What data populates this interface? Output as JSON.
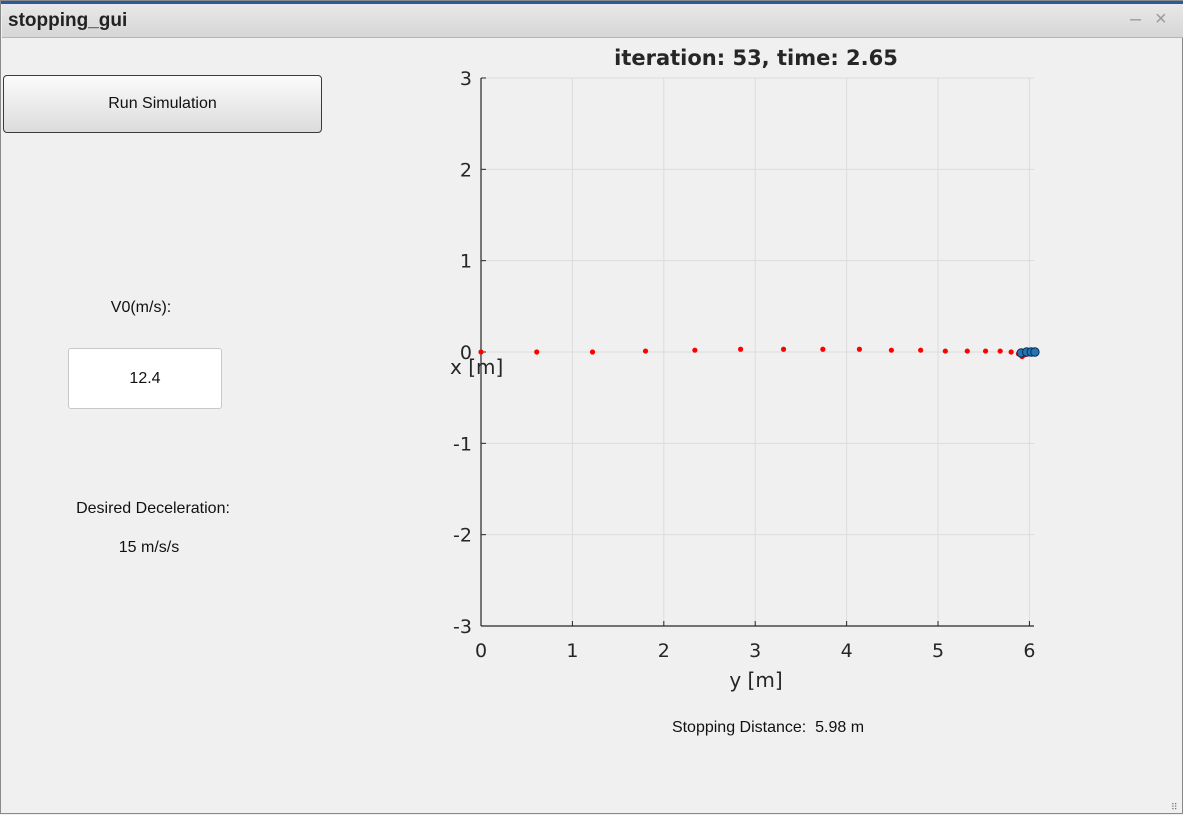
{
  "window": {
    "title": "stopping_gui",
    "minimize_glyph": "–",
    "close_glyph": "×"
  },
  "controls": {
    "run_button_label": "Run Simulation",
    "v0_label": "V0(m/s):",
    "v0_value": "12.4",
    "decel_label": "Desired Deceleration:",
    "decel_value": "15 m/s/s",
    "stopping_text": "Stopping Distance:  5.98 m"
  },
  "chart_data": {
    "type": "scatter",
    "title": "iteration: 53, time: 2.65",
    "xlabel": "y [m]",
    "ylabel": "x [m]",
    "xlim": [
      0,
      6.05
    ],
    "ylim": [
      -3,
      3
    ],
    "x_ticks": [
      0,
      1,
      2,
      3,
      4,
      5,
      6
    ],
    "y_ticks": [
      -3,
      -2,
      -1,
      0,
      1,
      2,
      3
    ],
    "grid": true,
    "colors": {
      "trail": "#ff0000",
      "marker": "#1f77b4",
      "grid": "#dcdcdc",
      "axis": "#262626"
    },
    "series": [
      {
        "points": [
          [
            0,
            0
          ],
          [
            0.61,
            0
          ],
          [
            1.22,
            0
          ],
          [
            1.8,
            0.01
          ],
          [
            2.34,
            0.02
          ],
          [
            2.84,
            0.03
          ],
          [
            3.31,
            0.03
          ],
          [
            3.74,
            0.03
          ],
          [
            4.14,
            0.03
          ],
          [
            4.49,
            0.02
          ],
          [
            4.81,
            0.02
          ],
          [
            5.08,
            0.01
          ],
          [
            5.32,
            0.01
          ],
          [
            5.52,
            0.01
          ],
          [
            5.68,
            0.01
          ],
          [
            5.8,
            0
          ],
          [
            5.88,
            -0.02
          ],
          [
            5.92,
            -0.05
          ],
          [
            5.95,
            -0.03
          ]
        ]
      },
      {
        "points": [
          [
            5.91,
            -0.01
          ],
          [
            5.97,
            0
          ],
          [
            6.02,
            0
          ],
          [
            6.06,
            0
          ]
        ]
      }
    ]
  }
}
